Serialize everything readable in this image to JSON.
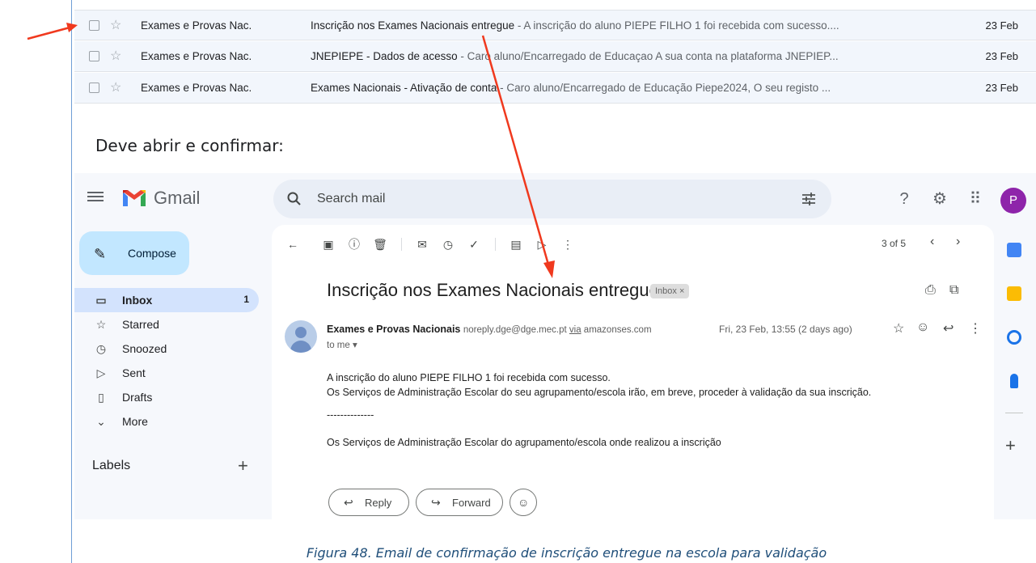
{
  "inbox_rows": [
    {
      "sender": "Exames e Provas Nac.",
      "subject": "Inscrição nos Exames Nacionais entregue",
      "preview": " - A inscrição do aluno PIEPE FILHO 1 foi recebida com sucesso....",
      "date": "23 Feb"
    },
    {
      "sender": "Exames e Provas Nac.",
      "subject": "JNEPIEPE - Dados de acesso",
      "preview": " - Caro aluno/Encarregado de Educaçao A sua conta na plataforma JNEPIEP...",
      "date": "23 Feb"
    },
    {
      "sender": "Exames e Provas Nac.",
      "subject": "Exames Nacionais - Ativação de conta",
      "preview": " - Caro aluno/Encarregado de Educação Piepe2024, O seu registo ...",
      "date": "23 Feb"
    }
  ],
  "instruction": "Deve abrir e confirmar:",
  "gmail": {
    "logo_text": "Gmail",
    "search_placeholder": "Search mail",
    "avatar_letter": "P",
    "compose_label": "Compose",
    "nav": [
      {
        "label": "Inbox",
        "count": "1",
        "icon": "inbox-icon"
      },
      {
        "label": "Starred",
        "count": "",
        "icon": "star-icon"
      },
      {
        "label": "Snoozed",
        "count": "",
        "icon": "clock-icon"
      },
      {
        "label": "Sent",
        "count": "",
        "icon": "send-icon"
      },
      {
        "label": "Drafts",
        "count": "",
        "icon": "draft-icon"
      },
      {
        "label": "More",
        "count": "",
        "icon": "chevron-down-icon"
      }
    ],
    "labels_header": "Labels",
    "pager": "3 of 5",
    "email": {
      "subject": "Inscrição nos Exames Nacionais entregue",
      "label_chip": "Inbox ×",
      "sender_name": "Exames e Provas Nacionais",
      "sender_email": "noreply.dge@dge.mec.pt",
      "via_label": "via",
      "via_domain": "amazonses.com",
      "to": "to me ▾",
      "date": "Fri, 23 Feb, 13:55 (2 days ago)",
      "body": [
        "A inscrição do aluno PIEPE FILHO 1 foi recebida com sucesso.",
        "Os Serviços de Administração Escolar do seu agrupamento/escola irão, em breve, proceder à validação da sua inscrição.",
        "--------------",
        "Os Serviços de Administração Escolar do agrupamento/escola onde realizou a inscrição"
      ]
    },
    "reply_label": "Reply",
    "forward_label": "Forward"
  },
  "caption": "Figura 48. Email de confirmação de inscrição entregue na escola para validação",
  "colors": {
    "annotation_arrow": "#f0391e",
    "caption": "#1f4e79",
    "selected_nav": "#d3e3fd",
    "compose": "#c2e7ff"
  }
}
